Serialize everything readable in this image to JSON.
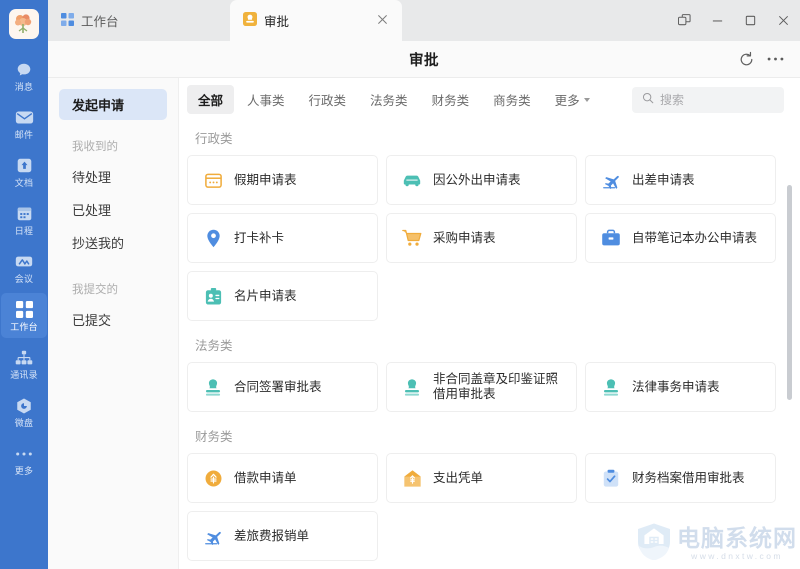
{
  "rail": {
    "avatar_icon": "flower-bouquet-avatar",
    "items": [
      {
        "label": "消息",
        "icon": "chat-bubble-icon",
        "active": false
      },
      {
        "label": "邮件",
        "icon": "envelope-icon",
        "active": false
      },
      {
        "label": "文档",
        "icon": "document-icon",
        "active": false
      },
      {
        "label": "日程",
        "icon": "calendar-icon",
        "active": false
      },
      {
        "label": "会议",
        "icon": "video-meeting-icon",
        "active": false
      },
      {
        "label": "工作台",
        "icon": "grid-workbench-icon",
        "active": true
      },
      {
        "label": "通讯录",
        "icon": "org-contacts-icon",
        "active": false
      },
      {
        "label": "微盘",
        "icon": "cloud-disk-icon",
        "active": false
      },
      {
        "label": "更多",
        "icon": "ellipsis-icon",
        "active": false
      }
    ]
  },
  "tabs": [
    {
      "label": "工作台",
      "icon": "grid-workbench-icon",
      "active": false,
      "closable": false
    },
    {
      "label": "审批",
      "icon": "approval-stamp-icon",
      "active": true,
      "closable": true
    }
  ],
  "window_controls": {
    "restore_split": "split-window-icon",
    "minimize": "minimize-icon",
    "maximize": "maximize-icon",
    "close": "close-icon"
  },
  "header": {
    "title": "审批",
    "refresh_icon": "refresh-icon",
    "more_icon": "more-horizontal-icon"
  },
  "sidenav": {
    "primary": {
      "label": "发起申请",
      "active": true
    },
    "groups": [
      {
        "title": "我收到的",
        "items": [
          {
            "label": "待处理"
          },
          {
            "label": "已处理"
          },
          {
            "label": "抄送我的"
          }
        ]
      },
      {
        "title": "我提交的",
        "items": [
          {
            "label": "已提交"
          }
        ]
      }
    ]
  },
  "filters": {
    "chips": [
      {
        "label": "全部",
        "active": true
      },
      {
        "label": "人事类",
        "active": false
      },
      {
        "label": "行政类",
        "active": false
      },
      {
        "label": "法务类",
        "active": false
      },
      {
        "label": "财务类",
        "active": false
      },
      {
        "label": "商务类",
        "active": false
      }
    ],
    "more_label": "更多",
    "search_placeholder": "搜索",
    "search_value": "",
    "search_icon": "search-icon"
  },
  "sections": [
    {
      "title": "行政类",
      "cards": [
        {
          "label": "假期申请表",
          "icon": "calendar-icon",
          "color": "#f0ac3c"
        },
        {
          "label": "因公外出申请表",
          "icon": "car-icon",
          "color": "#4cbfb4"
        },
        {
          "label": "出差申请表",
          "icon": "airplane-icon",
          "color": "#4f8de0"
        },
        {
          "label": "打卡补卡",
          "icon": "location-pin-icon",
          "color": "#4f8de0"
        },
        {
          "label": "采购申请表",
          "icon": "shopping-cart-icon",
          "color": "#f0ac3c"
        },
        {
          "label": "自带笔记本办公申请表",
          "icon": "briefcase-icon",
          "color": "#4f8de0"
        },
        {
          "label": "名片申请表",
          "icon": "id-card-icon",
          "color": "#4cbfb4"
        }
      ]
    },
    {
      "title": "法务类",
      "cards": [
        {
          "label": "合同签署审批表",
          "icon": "stamp-icon",
          "color": "#4cbfb4"
        },
        {
          "label": "非合同盖章及印鉴证照借用审批表",
          "icon": "stamp-icon",
          "color": "#4cbfb4"
        },
        {
          "label": "法律事务申请表",
          "icon": "stamp-icon",
          "color": "#4cbfb4"
        }
      ]
    },
    {
      "title": "财务类",
      "cards": [
        {
          "label": "借款申请单",
          "icon": "coin-icon",
          "color": "#f0ac3c"
        },
        {
          "label": "支出凭单",
          "icon": "house-money-icon",
          "color": "#f0ac3c"
        },
        {
          "label": "财务档案借用审批表",
          "icon": "clipboard-check-icon",
          "color": "#4f8de0"
        },
        {
          "label": "差旅费报销单",
          "icon": "airplane-icon",
          "color": "#4f8de0"
        }
      ]
    }
  ],
  "watermark": {
    "main": "电脑系统网",
    "sub": "www.dnxtw.com",
    "icon": "shield-house-icon"
  },
  "colors": {
    "rail_bg": "#3d76cc",
    "accent": "#4f8de0",
    "nav_active_bg": "#dbe6f7"
  }
}
